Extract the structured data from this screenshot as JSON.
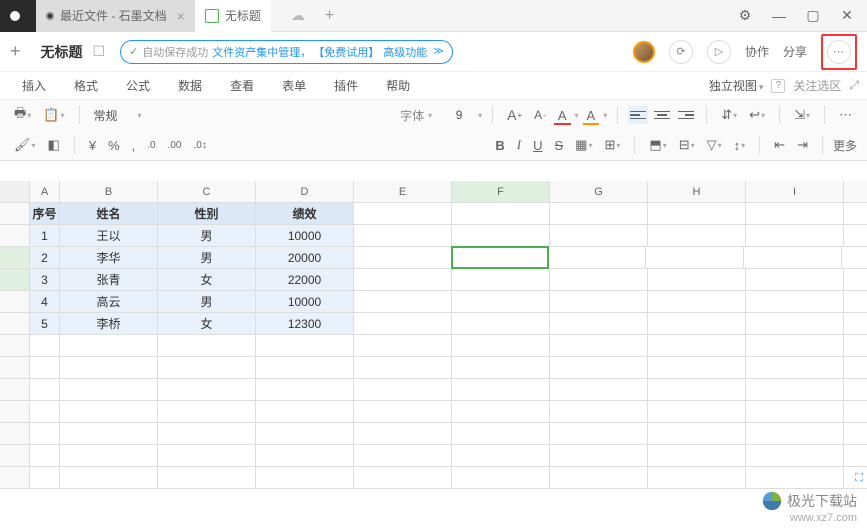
{
  "titlebar": {
    "tab1": "最近文件 - 石墨文档",
    "tab2": "无标题"
  },
  "secbar": {
    "doc_title": "无标题",
    "autosave_status": "自动保存成功",
    "asset_mgmt": "文件资产集中管理，",
    "trial": "【免费试用】",
    "advanced": "高级功能",
    "collab": "协作",
    "share": "分享"
  },
  "menubar": {
    "insert": "插入",
    "format": "格式",
    "formula": "公式",
    "data": "数据",
    "view": "查看",
    "form": "表单",
    "plugin": "插件",
    "help": "帮助",
    "independent_view": "独立视图",
    "follow_area": "关注选区"
  },
  "toolbar": {
    "font_name": "常规",
    "font_label": "字体",
    "font_size": "9",
    "percent": "%",
    "decimal_dec": ".0",
    "decimal_inc": ".00",
    "decimal_toggle": ".0↕",
    "bold": "B",
    "italic": "I",
    "underline": "U",
    "strike": "S",
    "more": "更多",
    "a_big": "A",
    "a_small": "A"
  },
  "sheet": {
    "cols": [
      "A",
      "B",
      "C",
      "D",
      "E",
      "F",
      "G",
      "H",
      "I"
    ],
    "headers": {
      "A": "序号",
      "B": "姓名",
      "C": "性别",
      "D": "绩效"
    },
    "rows": [
      {
        "n": "1",
        "name": "王以",
        "gender": "男",
        "perf": "10000"
      },
      {
        "n": "2",
        "name": "李华",
        "gender": "男",
        "perf": "20000"
      },
      {
        "n": "3",
        "name": "张青",
        "gender": "女",
        "perf": "22000"
      },
      {
        "n": "4",
        "name": "高云",
        "gender": "男",
        "perf": "10000"
      },
      {
        "n": "5",
        "name": "李桥",
        "gender": "女",
        "perf": "12300"
      }
    ],
    "selected_cell": "F3"
  },
  "watermark": {
    "brand": "极光下载站",
    "url": "www.xz7.com"
  }
}
